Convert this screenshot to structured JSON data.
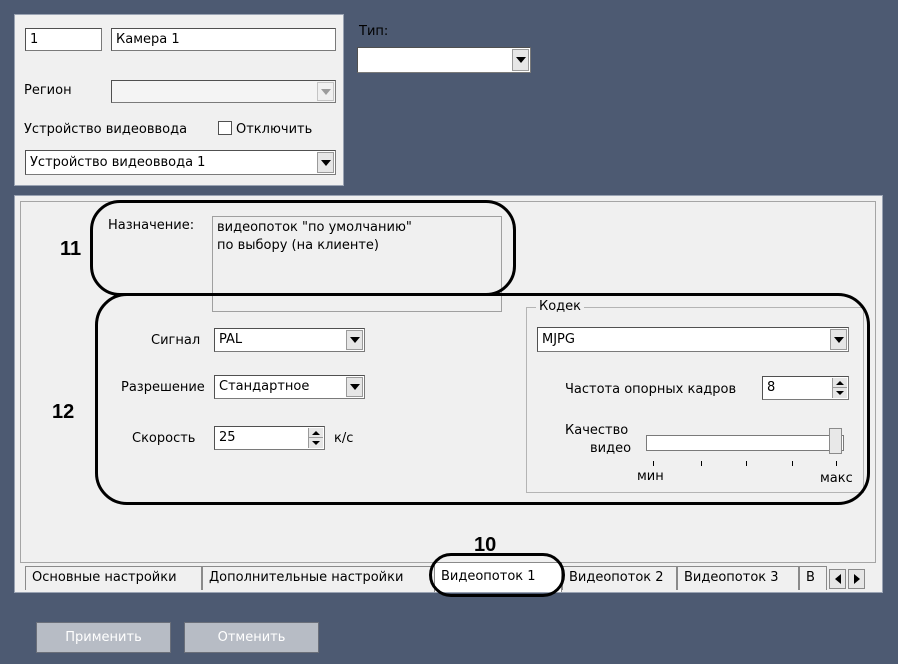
{
  "camera": {
    "number": "1",
    "name": "Камера 1"
  },
  "type": {
    "label": "Тип:",
    "value": ""
  },
  "region": {
    "label": "Регион",
    "value": ""
  },
  "device": {
    "label": "Устройство видеоввода",
    "disable_label": "Отключить",
    "disabled": false,
    "value": "Устройство видеоввода 1"
  },
  "purpose": {
    "label": "Назначение:",
    "items": [
      "видеопоток \"по умолчанию\"",
      "по выбору (на клиенте)"
    ]
  },
  "signal": {
    "label": "Сигнал",
    "value": "PAL"
  },
  "resolution": {
    "label": "Разрешение",
    "value": "Стандартное"
  },
  "speed": {
    "label": "Скорость",
    "value": "25",
    "unit": "к/с"
  },
  "codec": {
    "group_label": "Кодек",
    "value": "MJPG",
    "keyframe_label": "Частота опорных кадров",
    "keyframe_value": "8",
    "quality_label_1": "Качество",
    "quality_label_2": "видео",
    "quality_min": "мин",
    "quality_max": "макс",
    "quality_level": 1.0
  },
  "callouts": {
    "purpose": "11",
    "stream": "12",
    "tab": "10"
  },
  "tabs": [
    "Основные настройки",
    "Дополнительные настройки",
    "Видеопоток 1",
    "Видеопоток 2",
    "Видеопоток 3",
    "В"
  ],
  "active_tab": "Видеопоток 1",
  "buttons": {
    "apply": "Применить",
    "cancel": "Отменить"
  },
  "colors": {
    "background": "#4d5a72",
    "panel": "#f0f0f0",
    "button": "#b7bcc5"
  }
}
